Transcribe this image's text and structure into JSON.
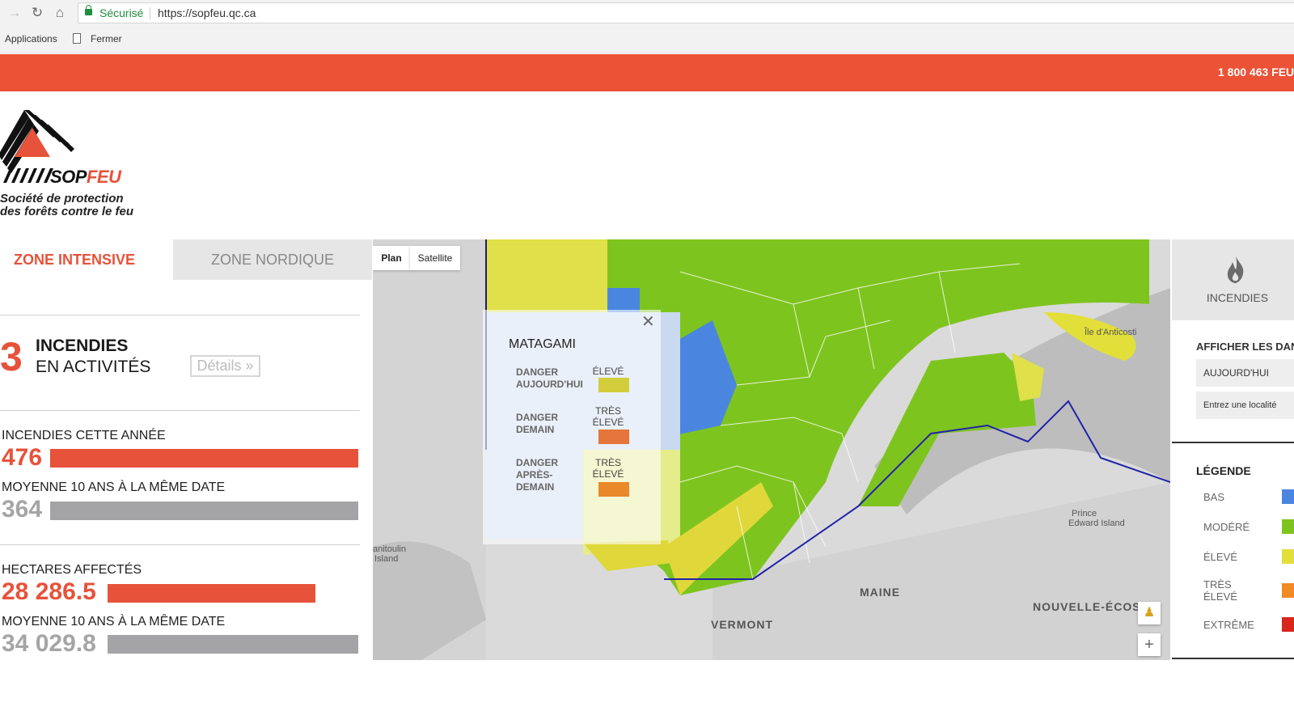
{
  "browser": {
    "secure_label": "Sécurisé",
    "url": "https://sopfeu.qc.ca",
    "bookmarks": [
      "Applications",
      "Fermer"
    ]
  },
  "banner": {
    "phone": "1 800 463 FEU"
  },
  "logo": {
    "name": "SOPFEU",
    "subtitle_line1": "Société de protection",
    "subtitle_line2": "des forêts contre le feu"
  },
  "tabs": [
    {
      "label": "ZONE INTENSIVE",
      "active": true
    },
    {
      "label": "ZONE NORDIQUE",
      "active": false
    }
  ],
  "fires_active": {
    "count": "3",
    "line1": "INCENDIES",
    "line2": "EN ACTIVITÉS",
    "details_label": "Détails »"
  },
  "stats": {
    "fires_year": {
      "label": "INCENDIES CETTE ANNÉE",
      "value": "476",
      "numeric": 476
    },
    "fires_avg": {
      "label": "MOYENNE 10 ANS À LA MÊME DATE",
      "value": "364",
      "numeric": 364
    },
    "hectares": {
      "label": "HECTARES AFFECTÉS",
      "value": "28 286.5",
      "numeric": 28286.5
    },
    "hectares_avg": {
      "label": "MOYENNE 10 ANS À LA MÊME DATE",
      "value": "34 029.8",
      "numeric": 34029.8
    }
  },
  "map": {
    "type_buttons": [
      "Plan",
      "Satellite"
    ],
    "labels": {
      "maine": "MAINE",
      "vermont": "VERMONT",
      "nova_scotia": "NOUVELLE-ÉCOS",
      "pei_line1": "Prince",
      "pei_line2": "Edward Island",
      "anticosti": "Île d'Anticosti",
      "manitoulin_line1": "anitoulin",
      "manitoulin_line2": "Island"
    },
    "zoom_in": "+",
    "popup": {
      "title": "MATAGAMI",
      "rows": [
        {
          "label_l1": "DANGER",
          "label_l2": "AUJOURD'HUI",
          "label_l3": "",
          "val_l1": "ÉLEVÉ",
          "val_l2": "",
          "color": "#d3cd3b"
        },
        {
          "label_l1": "DANGER",
          "label_l2": "DEMAIN",
          "label_l3": "",
          "val_l1": "TRÈS",
          "val_l2": "ÉLEVÉ",
          "color": "#e5753a"
        },
        {
          "label_l1": "DANGER",
          "label_l2": "APRÈS-",
          "label_l3": "DEMAIN",
          "val_l1": "TRÈS",
          "val_l2": "ÉLEVÉ",
          "color": "#e9892a"
        }
      ]
    }
  },
  "right_panel": {
    "fires_label": "INCENDIES",
    "show_label": "AFFICHER LES DANGERS",
    "day_select": "AUJOURD'HUI",
    "locality_placeholder": "Entrez une localité",
    "legend_title": "LÉGENDE",
    "legend": [
      {
        "label_l1": "BAS",
        "label_l2": "",
        "color": "#4a86e0"
      },
      {
        "label_l1": "MODÉRÉ",
        "label_l2": "",
        "color": "#7ec41f"
      },
      {
        "label_l1": "ÉLEVÉ",
        "label_l2": "",
        "color": "#e3df3a"
      },
      {
        "label_l1": "TRÈS",
        "label_l2": "ÉLEVÉ",
        "color": "#f08a22"
      },
      {
        "label_l1": "EXTRÊME",
        "label_l2": "",
        "color": "#d8261c"
      }
    ]
  },
  "colors": {
    "accent": "#eb5236",
    "stat_red": "#e7523a",
    "stat_gray": "#a4a4a6",
    "danger_low": "#4a86e0",
    "danger_moderate": "#7ec41f",
    "danger_high": "#e3df3a"
  }
}
